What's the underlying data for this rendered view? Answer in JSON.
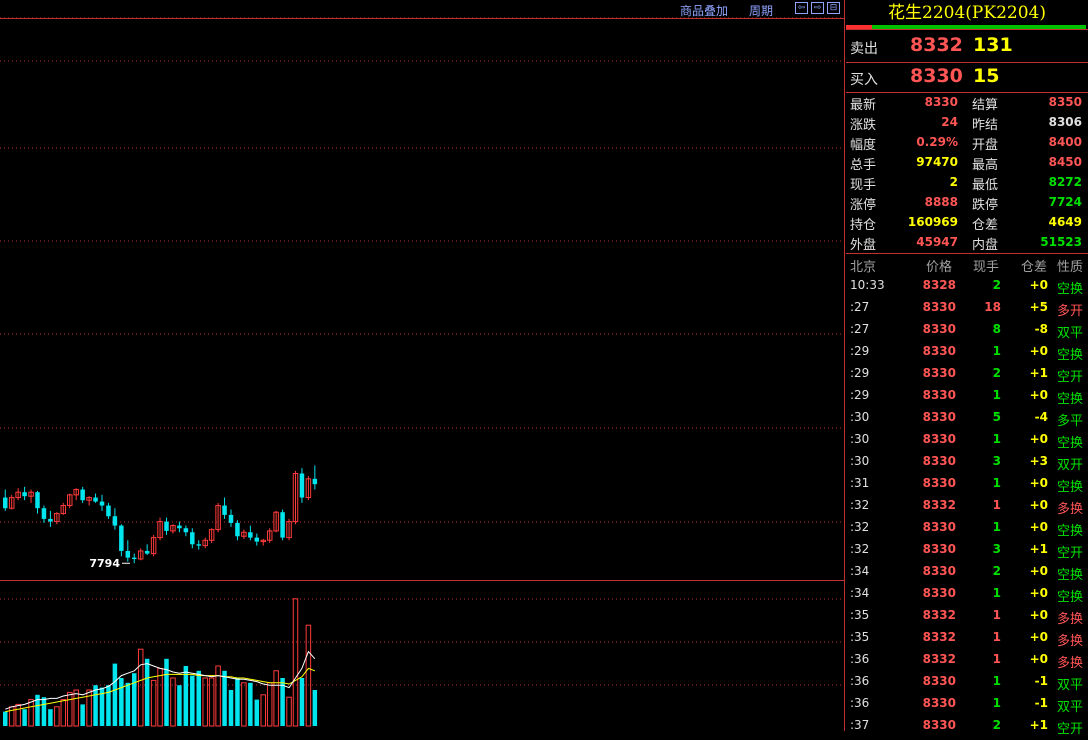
{
  "toolbar": {
    "overlay_label": "商品叠加",
    "period_label": "周期",
    "btn_left": "⇦",
    "btn_right": "⇨",
    "btn_split": "⊟"
  },
  "colors": {
    "up": "#ff3b3b",
    "down": "#00e5ee",
    "ma_white": "#ffffff",
    "ma_yellow": "#ffff00",
    "grid": "#c03030"
  },
  "chart_data": {
    "type": "candlestick",
    "low_marker": "7794",
    "price_range": [
      7750,
      8480
    ],
    "candles": [
      [
        8040,
        8070,
        7990,
        8000
      ],
      [
        8000,
        8050,
        7995,
        8040
      ],
      [
        8040,
        8075,
        8030,
        8060
      ],
      [
        8060,
        8080,
        8030,
        8045
      ],
      [
        8045,
        8070,
        8020,
        8060
      ],
      [
        8060,
        8065,
        7980,
        8000
      ],
      [
        8000,
        8010,
        7945,
        7960
      ],
      [
        7960,
        7990,
        7930,
        7950
      ],
      [
        7950,
        7985,
        7940,
        7980
      ],
      [
        7980,
        8020,
        7975,
        8010
      ],
      [
        8010,
        8055,
        8000,
        8050
      ],
      [
        8050,
        8075,
        8030,
        8070
      ],
      [
        8070,
        8080,
        8020,
        8030
      ],
      [
        8030,
        8045,
        8010,
        8040
      ],
      [
        8040,
        8055,
        8020,
        8025
      ],
      [
        8025,
        8050,
        7990,
        8010
      ],
      [
        8010,
        8020,
        7960,
        7970
      ],
      [
        7970,
        8000,
        7920,
        7935
      ],
      [
        7935,
        7940,
        7820,
        7840
      ],
      [
        7840,
        7880,
        7800,
        7815
      ],
      [
        7815,
        7830,
        7794,
        7810
      ],
      [
        7810,
        7850,
        7805,
        7840
      ],
      [
        7840,
        7865,
        7825,
        7830
      ],
      [
        7830,
        7900,
        7820,
        7890
      ],
      [
        7890,
        7965,
        7880,
        7950
      ],
      [
        7950,
        7965,
        7900,
        7915
      ],
      [
        7915,
        7940,
        7905,
        7935
      ],
      [
        7935,
        7950,
        7910,
        7925
      ],
      [
        7925,
        7935,
        7895,
        7910
      ],
      [
        7910,
        7925,
        7850,
        7865
      ],
      [
        7865,
        7880,
        7845,
        7860
      ],
      [
        7860,
        7890,
        7850,
        7880
      ],
      [
        7880,
        7925,
        7870,
        7920
      ],
      [
        7920,
        8020,
        7910,
        8010
      ],
      [
        8010,
        8040,
        7960,
        7975
      ],
      [
        7975,
        7995,
        7930,
        7945
      ],
      [
        7945,
        7955,
        7880,
        7895
      ],
      [
        7895,
        7920,
        7885,
        7910
      ],
      [
        7910,
        7935,
        7880,
        7890
      ],
      [
        7890,
        7905,
        7860,
        7875
      ],
      [
        7875,
        7885,
        7860,
        7880
      ],
      [
        7880,
        7925,
        7870,
        7915
      ],
      [
        7915,
        7990,
        7910,
        7985
      ],
      [
        7985,
        7995,
        7880,
        7890
      ],
      [
        7890,
        7960,
        7880,
        7950
      ],
      [
        7950,
        8140,
        7940,
        8130
      ],
      [
        8130,
        8150,
        8020,
        8040
      ],
      [
        8040,
        8120,
        8030,
        8110
      ],
      [
        8110,
        8160,
        8070,
        8090
      ]
    ],
    "volumes": [
      12,
      16,
      18,
      14,
      22,
      26,
      24,
      14,
      16,
      22,
      28,
      30,
      18,
      30,
      34,
      32,
      34,
      52,
      40,
      36,
      44,
      64,
      56,
      38,
      48,
      56,
      40,
      34,
      50,
      42,
      46,
      40,
      40,
      50,
      46,
      30,
      40,
      36,
      36,
      22,
      26,
      36,
      46,
      40,
      24,
      106,
      40,
      84,
      30
    ],
    "volume_ma_white": [
      14,
      16,
      17,
      18,
      20,
      22,
      22,
      23,
      23,
      25,
      26,
      27,
      26,
      28,
      30,
      31,
      33,
      37,
      42,
      44,
      46,
      51,
      52,
      50,
      48,
      47,
      45,
      44,
      45,
      44,
      43,
      42,
      41,
      42,
      41,
      40,
      39,
      39,
      38,
      37,
      35,
      34,
      34,
      34,
      32,
      40,
      48,
      62,
      56
    ],
    "volume_ma_yellow": [
      12,
      13,
      14,
      15,
      16,
      17,
      18,
      19,
      20,
      21,
      22,
      23,
      24,
      25,
      26,
      27,
      28,
      30,
      32,
      34,
      36,
      38,
      40,
      41,
      42,
      43,
      43,
      43,
      43,
      43,
      42,
      42,
      42,
      42,
      41,
      41,
      40,
      40,
      39,
      38,
      37,
      36,
      36,
      36,
      35,
      38,
      41,
      48,
      46
    ]
  },
  "quote": {
    "title": "花生2204(PK2204)",
    "orderbook": {
      "sell_label": "卖出",
      "sell_price": "8332",
      "sell_vol": "131",
      "buy_label": "买入",
      "buy_price": "8330",
      "buy_vol": "15"
    },
    "stats": [
      {
        "label": "最新",
        "value": "8330",
        "color": "#ff5555",
        "label2": "结算",
        "value2": "8350",
        "color2": "#ff5555"
      },
      {
        "label": "涨跌",
        "value": "24",
        "color": "#ff5555",
        "label2": "昨结",
        "value2": "8306",
        "color2": "#e0e0e0"
      },
      {
        "label": "幅度",
        "value": "0.29%",
        "color": "#ff5555",
        "label2": "开盘",
        "value2": "8400",
        "color2": "#ff5555"
      },
      {
        "label": "总手",
        "value": "97470",
        "color": "#ffff00",
        "label2": "最高",
        "value2": "8450",
        "color2": "#ff5555"
      },
      {
        "label": "现手",
        "value": "2",
        "color": "#ffff00",
        "label2": "最低",
        "value2": "8272",
        "color2": "#00e000"
      },
      {
        "label": "涨停",
        "value": "8888",
        "color": "#ff5555",
        "label2": "跌停",
        "value2": "7724",
        "color2": "#00e000"
      },
      {
        "label": "持仓",
        "value": "160969",
        "color": "#ffff00",
        "label2": "仓差",
        "value2": "4649",
        "color2": "#ffff00"
      },
      {
        "label": "外盘",
        "value": "45947",
        "color": "#ff5555",
        "label2": "内盘",
        "value2": "51523",
        "color2": "#00e000"
      }
    ],
    "tick_header": {
      "time": "北京",
      "price": "价格",
      "vol": "现手",
      "oi": "仓差",
      "nature": "性质"
    },
    "ticks": [
      {
        "time": "10:33",
        "price": "8328",
        "vol": "2",
        "oi": "+0",
        "nature": "空换",
        "pc": "#ff5555",
        "vc": "#00e000",
        "nc": "#00e000"
      },
      {
        "time": ":27",
        "price": "8330",
        "vol": "18",
        "oi": "+5",
        "nature": "多开",
        "pc": "#ff5555",
        "vc": "#ff5555",
        "nc": "#ff5555"
      },
      {
        "time": ":27",
        "price": "8330",
        "vol": "8",
        "oi": "-8",
        "nature": "双平",
        "pc": "#ff5555",
        "vc": "#00e000",
        "nc": "#00e000"
      },
      {
        "time": ":29",
        "price": "8330",
        "vol": "1",
        "oi": "+0",
        "nature": "空换",
        "pc": "#ff5555",
        "vc": "#00e000",
        "nc": "#00e000"
      },
      {
        "time": ":29",
        "price": "8330",
        "vol": "2",
        "oi": "+1",
        "nature": "空开",
        "pc": "#ff5555",
        "vc": "#00e000",
        "nc": "#00e000"
      },
      {
        "time": ":29",
        "price": "8330",
        "vol": "1",
        "oi": "+0",
        "nature": "空换",
        "pc": "#ff5555",
        "vc": "#00e000",
        "nc": "#00e000"
      },
      {
        "time": ":30",
        "price": "8330",
        "vol": "5",
        "oi": "-4",
        "nature": "多平",
        "pc": "#ff5555",
        "vc": "#00e000",
        "nc": "#00e000"
      },
      {
        "time": ":30",
        "price": "8330",
        "vol": "1",
        "oi": "+0",
        "nature": "空换",
        "pc": "#ff5555",
        "vc": "#00e000",
        "nc": "#00e000"
      },
      {
        "time": ":30",
        "price": "8330",
        "vol": "3",
        "oi": "+3",
        "nature": "双开",
        "pc": "#ff5555",
        "vc": "#00e000",
        "nc": "#00e000"
      },
      {
        "time": ":31",
        "price": "8330",
        "vol": "1",
        "oi": "+0",
        "nature": "空换",
        "pc": "#ff5555",
        "vc": "#00e000",
        "nc": "#00e000"
      },
      {
        "time": ":32",
        "price": "8332",
        "vol": "1",
        "oi": "+0",
        "nature": "多换",
        "pc": "#ff5555",
        "vc": "#ff5555",
        "nc": "#ff5555"
      },
      {
        "time": ":32",
        "price": "8330",
        "vol": "1",
        "oi": "+0",
        "nature": "空换",
        "pc": "#ff5555",
        "vc": "#00e000",
        "nc": "#00e000"
      },
      {
        "time": ":32",
        "price": "8330",
        "vol": "3",
        "oi": "+1",
        "nature": "空开",
        "pc": "#ff5555",
        "vc": "#00e000",
        "nc": "#00e000"
      },
      {
        "time": ":34",
        "price": "8330",
        "vol": "2",
        "oi": "+0",
        "nature": "空换",
        "pc": "#ff5555",
        "vc": "#00e000",
        "nc": "#00e000"
      },
      {
        "time": ":34",
        "price": "8330",
        "vol": "1",
        "oi": "+0",
        "nature": "空换",
        "pc": "#ff5555",
        "vc": "#00e000",
        "nc": "#00e000"
      },
      {
        "time": ":35",
        "price": "8332",
        "vol": "1",
        "oi": "+0",
        "nature": "多换",
        "pc": "#ff5555",
        "vc": "#ff5555",
        "nc": "#ff5555"
      },
      {
        "time": ":35",
        "price": "8332",
        "vol": "1",
        "oi": "+0",
        "nature": "多换",
        "pc": "#ff5555",
        "vc": "#ff5555",
        "nc": "#ff5555"
      },
      {
        "time": ":36",
        "price": "8332",
        "vol": "1",
        "oi": "+0",
        "nature": "多换",
        "pc": "#ff5555",
        "vc": "#ff5555",
        "nc": "#ff5555"
      },
      {
        "time": ":36",
        "price": "8330",
        "vol": "1",
        "oi": "-1",
        "nature": "双平",
        "pc": "#ff5555",
        "vc": "#00e000",
        "nc": "#00e000"
      },
      {
        "time": ":36",
        "price": "8330",
        "vol": "1",
        "oi": "-1",
        "nature": "双平",
        "pc": "#ff5555",
        "vc": "#00e000",
        "nc": "#00e000"
      },
      {
        "time": ":37",
        "price": "8330",
        "vol": "2",
        "oi": "+1",
        "nature": "空开",
        "pc": "#ff5555",
        "vc": "#00e000",
        "nc": "#00e000"
      }
    ]
  }
}
